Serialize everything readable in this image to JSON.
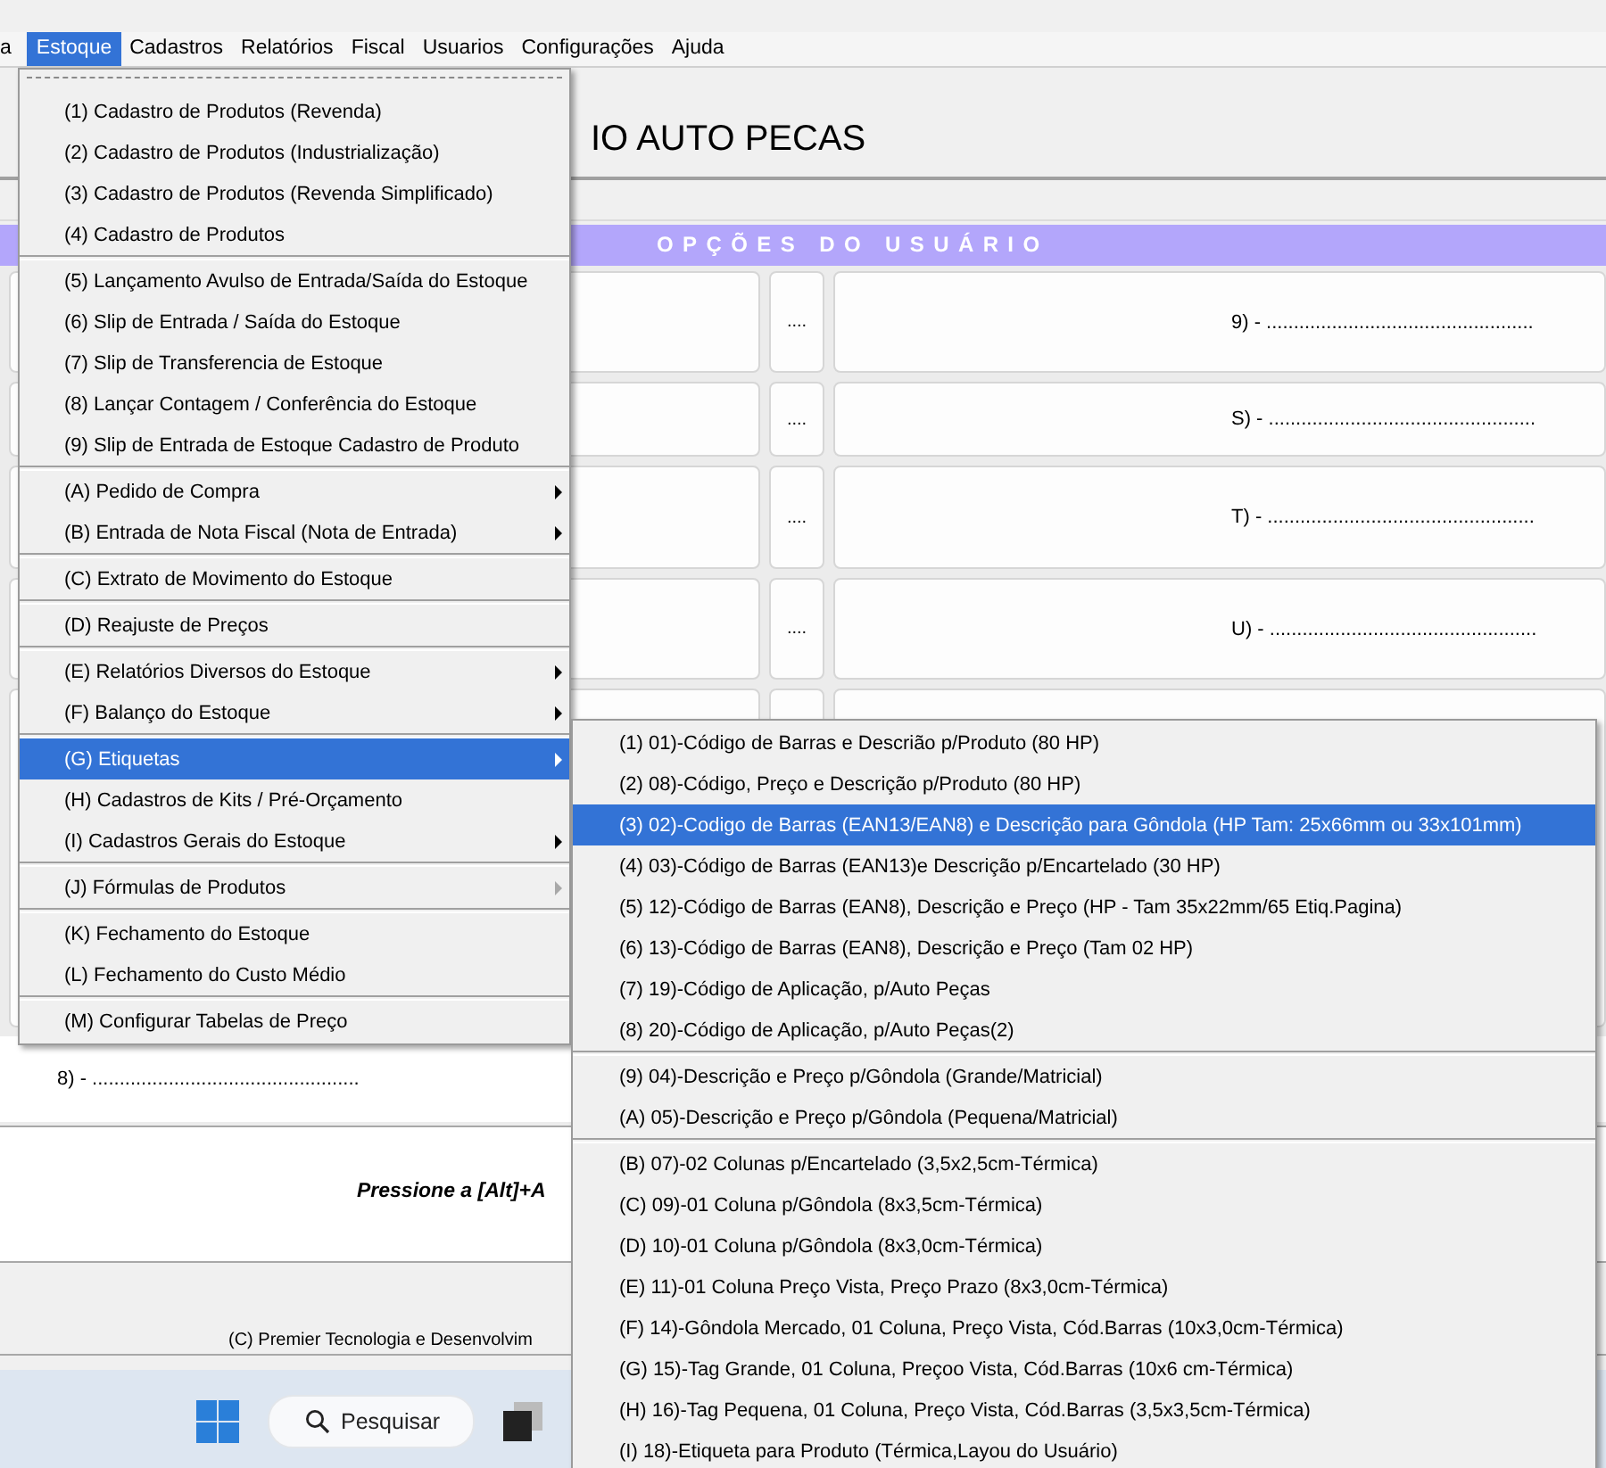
{
  "menubar": {
    "items": [
      {
        "label": "a",
        "selected": false
      },
      {
        "label": "Estoque",
        "selected": true
      },
      {
        "label": "Cadastros",
        "selected": false
      },
      {
        "label": "Relatórios",
        "selected": false
      },
      {
        "label": "Fiscal",
        "selected": false
      },
      {
        "label": "Usuarios",
        "selected": false
      },
      {
        "label": "Configurações",
        "selected": false
      },
      {
        "label": "Ajuda",
        "selected": false
      }
    ]
  },
  "header": {
    "title": "IO AUTO PECAS"
  },
  "options_panel": {
    "title": "OPÇÕES DO USUÁRIO",
    "rows": [
      {
        "button": "....",
        "label": "9) - ................................................."
      },
      {
        "button": "....",
        "label": "S) - ................................................."
      },
      {
        "button": "....",
        "label": "T) - ................................................."
      },
      {
        "button": "....",
        "label": "U) - ................................................."
      }
    ],
    "bottom_label": "8) - ................................................."
  },
  "hint": "Pressione a [Alt]+A",
  "footer": "(C) Premier Tecnologia e Desenvolvim",
  "taskbar": {
    "search": "Pesquisar"
  },
  "menu": {
    "groups": [
      {
        "items": [
          {
            "label": "(1) Cadastro de Produtos (Revenda)",
            "has_submenu": false,
            "selected": false
          },
          {
            "label": "(2) Cadastro de Produtos (Industrialização)",
            "has_submenu": false,
            "selected": false
          },
          {
            "label": "(3) Cadastro de Produtos (Revenda Simplificado)",
            "has_submenu": false,
            "selected": false
          },
          {
            "label": "(4) Cadastro de Produtos",
            "has_submenu": false,
            "selected": false
          }
        ]
      },
      {
        "items": [
          {
            "label": "(5) Lançamento Avulso de Entrada/Saída do Estoque",
            "has_submenu": false,
            "selected": false
          },
          {
            "label": "(6) Slip de Entrada / Saída do Estoque",
            "has_submenu": false,
            "selected": false
          },
          {
            "label": "(7) Slip de Transferencia de Estoque",
            "has_submenu": false,
            "selected": false
          },
          {
            "label": "(8) Lançar Contagem / Conferência do Estoque",
            "has_submenu": false,
            "selected": false
          },
          {
            "label": "(9) Slip de Entrada de Estoque Cadastro de Produto",
            "has_submenu": false,
            "selected": false
          }
        ]
      },
      {
        "items": [
          {
            "label": "(A) Pedido de Compra",
            "has_submenu": true,
            "arrow_disabled": false,
            "selected": false
          },
          {
            "label": "(B) Entrada de Nota Fiscal (Nota de Entrada)",
            "has_submenu": true,
            "arrow_disabled": false,
            "selected": false
          }
        ]
      },
      {
        "items": [
          {
            "label": "(C) Extrato de Movimento do Estoque",
            "has_submenu": false,
            "selected": false
          }
        ]
      },
      {
        "items": [
          {
            "label": "(D) Reajuste de Preços",
            "has_submenu": false,
            "selected": false
          }
        ]
      },
      {
        "items": [
          {
            "label": "(E) Relatórios Diversos do Estoque",
            "has_submenu": true,
            "arrow_disabled": false,
            "selected": false
          },
          {
            "label": "(F) Balanço do Estoque",
            "has_submenu": true,
            "arrow_disabled": false,
            "selected": false
          }
        ]
      },
      {
        "items": [
          {
            "label": "(G) Etiquetas",
            "has_submenu": true,
            "arrow_disabled": false,
            "selected": true
          },
          {
            "label": "(H) Cadastros de Kits / Pré-Orçamento",
            "has_submenu": false,
            "selected": false
          },
          {
            "label": "(I) Cadastros Gerais do Estoque",
            "has_submenu": true,
            "arrow_disabled": false,
            "selected": false
          }
        ]
      },
      {
        "items": [
          {
            "label": "(J) Fórmulas de Produtos",
            "has_submenu": true,
            "arrow_disabled": true,
            "selected": false
          }
        ]
      },
      {
        "items": [
          {
            "label": "(K) Fechamento do Estoque",
            "has_submenu": false,
            "selected": false
          },
          {
            "label": "(L) Fechamento do Custo Médio",
            "has_submenu": false,
            "selected": false
          }
        ]
      },
      {
        "items": [
          {
            "label": "(M) Configurar Tabelas de Preço",
            "has_submenu": false,
            "selected": false
          }
        ]
      }
    ]
  },
  "submenu": {
    "groups": [
      {
        "items": [
          {
            "label": "(1) 01)-Código de Barras e Descrião p/Produto (80 HP)",
            "selected": false
          },
          {
            "label": "(2) 08)-Código, Preço e Descrição p/Produto (80 HP)",
            "selected": false
          },
          {
            "label": "(3) 02)-Codigo de Barras (EAN13/EAN8) e Descrição para Gôndola (HP Tam: 25x66mm ou 33x101mm)",
            "selected": true
          },
          {
            "label": "(4) 03)-Código de Barras (EAN13)e Descrição p/Encartelado (30 HP)",
            "selected": false
          },
          {
            "label": "(5) 12)-Código de Barras (EAN8), Descrição e Preço (HP - Tam 35x22mm/65 Etiq.Pagina)",
            "selected": false
          },
          {
            "label": "(6) 13)-Código de Barras (EAN8), Descrição e Preço (Tam 02 HP)",
            "selected": false
          },
          {
            "label": "(7) 19)-Código de Aplicação, p/Auto Peças",
            "selected": false
          },
          {
            "label": "(8) 20)-Código de Aplicação, p/Auto Peças(2)",
            "selected": false
          }
        ]
      },
      {
        "items": [
          {
            "label": "(9) 04)-Descrição e Preço p/Gôndola (Grande/Matricial)",
            "selected": false
          },
          {
            "label": "(A) 05)-Descrição e Preço p/Gôndola (Pequena/Matricial)",
            "selected": false
          }
        ]
      },
      {
        "items": [
          {
            "label": "(B) 07)-02 Colunas p/Encartelado (3,5x2,5cm-Térmica)",
            "selected": false
          },
          {
            "label": "(C) 09)-01 Coluna p/Gôndola (8x3,5cm-Térmica)",
            "selected": false
          },
          {
            "label": "(D) 10)-01 Coluna p/Gôndola (8x3,0cm-Térmica)",
            "selected": false
          },
          {
            "label": "(E) 11)-01 Coluna Preço Vista, Preço Prazo (8x3,0cm-Térmica)",
            "selected": false
          },
          {
            "label": "(F) 14)-Gôndola Mercado, 01 Coluna, Preço Vista, Cód.Barras (10x3,0cm-Térmica)",
            "selected": false
          },
          {
            "label": "(G) 15)-Tag Grande, 01 Coluna, Preçoo Vista, Cód.Barras (10x6 cm-Térmica)",
            "selected": false
          },
          {
            "label": "(H) 16)-Tag Pequena, 01 Coluna, Preço Vista, Cód.Barras (3,5x3,5cm-Térmica)",
            "selected": false
          },
          {
            "label": "(I) 18)-Etiqueta para Produto (Térmica,Layou do Usuário)",
            "selected": false
          }
        ]
      }
    ]
  }
}
